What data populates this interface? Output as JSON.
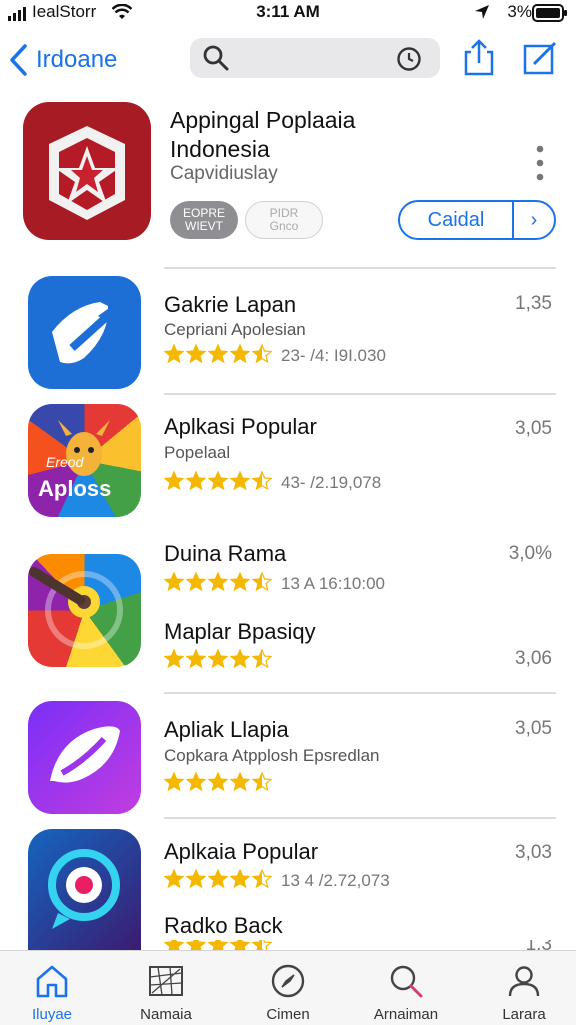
{
  "status_bar": {
    "carrier": "IealStorr",
    "time": "3:11 AM",
    "battery": "3%"
  },
  "nav": {
    "back_label": "Irdoane"
  },
  "featured": {
    "title_line1": "Appingal Poplaaia",
    "title_line2": "Indonesia",
    "subtitle": "Capvidiuslay",
    "badge1_line1": "EOPRE",
    "badge1_line2": "WIEVT",
    "badge2_line1": "PIDR",
    "badge2_line2": "Gnco",
    "get_label": "Caidal",
    "get_arrow": "›"
  },
  "apps": [
    {
      "name": "Gakrie Lapan",
      "category": "Cepriani Apolesian",
      "time": "1,35",
      "rating": 4.5,
      "rating_text": "23- /4: I9I.030"
    },
    {
      "name": "Aplkasi Popular",
      "category": "Popelaal",
      "time": "3,05",
      "rating": 4.5,
      "rating_text": "43- /2.19,078",
      "icon_text_top": "Ereod",
      "icon_text_bottom": "Aploss"
    },
    {
      "name": "Duina Rama",
      "category": "",
      "time": "3,0%",
      "rating": 4.5,
      "rating_text": "13 A 16:10:00"
    },
    {
      "name": "Maplar Bpasiqy",
      "category": "",
      "time": "3,06",
      "rating": 4.5,
      "rating_text": ""
    },
    {
      "name": "Apliak Llapia",
      "category": "Copkara Atpplosh Epsredlan",
      "time": "3,05",
      "rating": 4.5,
      "rating_text": ""
    },
    {
      "name": "Aplkaia Popular",
      "category": "",
      "time": "3,03",
      "rating": 4.5,
      "rating_text": "13 4 /2.72,073"
    },
    {
      "name": "Radko Back",
      "category": "",
      "time": "1.3",
      "rating": 4.5,
      "rating_text": ""
    }
  ],
  "tabs": [
    {
      "label": "Iluyae",
      "icon": "home-icon",
      "active": true
    },
    {
      "label": "Namaia",
      "icon": "map-icon",
      "active": false
    },
    {
      "label": "Cimen",
      "icon": "compass-icon",
      "active": false
    },
    {
      "label": "Arnaiman",
      "icon": "search-icon",
      "active": false
    },
    {
      "label": "Larara",
      "icon": "person-icon",
      "active": false
    }
  ],
  "colors": {
    "accent": "#1a73e8",
    "star": "#f5b800"
  }
}
